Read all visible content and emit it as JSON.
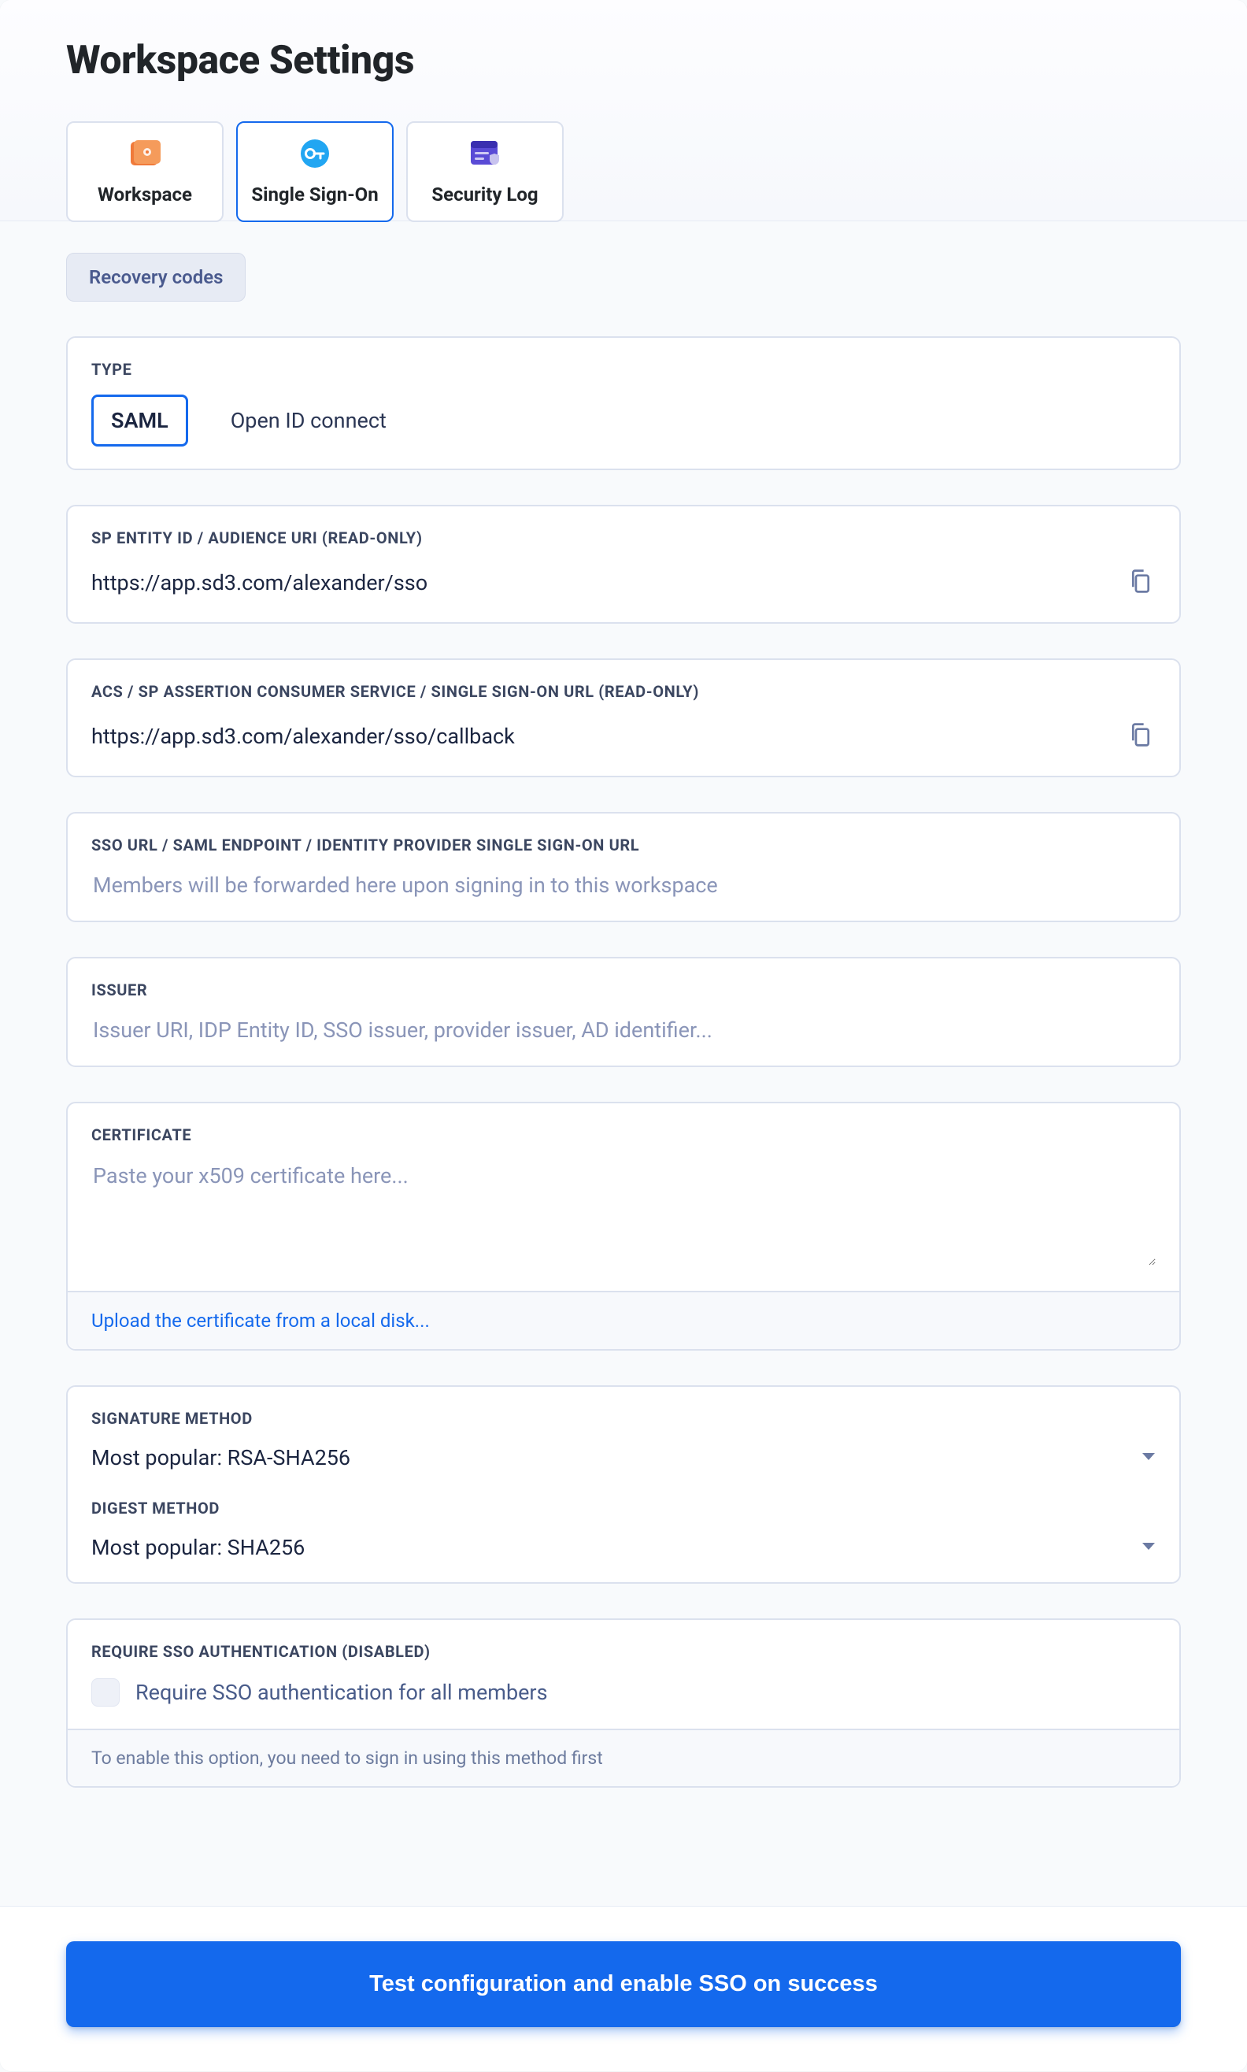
{
  "page_title": "Workspace Settings",
  "tabs": [
    {
      "label": "Workspace",
      "icon": "workspace-icon"
    },
    {
      "label": "Single Sign-On",
      "icon": "key-icon"
    },
    {
      "label": "Security Log",
      "icon": "security-log-icon"
    }
  ],
  "active_tab": "Single Sign-On",
  "recovery_codes_label": "Recovery codes",
  "type_section": {
    "label": "TYPE",
    "options": [
      "SAML",
      "Open ID connect"
    ],
    "selected": "SAML"
  },
  "sp_entity": {
    "label": "SP ENTITY ID / AUDIENCE URI (READ-ONLY)",
    "value": "https://app.sd3.com/alexander/sso"
  },
  "acs": {
    "label": "ACS / SP ASSERTION CONSUMER SERVICE / SINGLE SIGN-ON URL (READ-ONLY)",
    "value": "https://app.sd3.com/alexander/sso/callback"
  },
  "sso_url": {
    "label": "SSO URL / SAML ENDPOINT / IDENTITY PROVIDER SINGLE SIGN-ON URL",
    "placeholder": "Members will be forwarded here upon signing in to this workspace"
  },
  "issuer": {
    "label": "ISSUER",
    "placeholder": "Issuer URI, IDP Entity ID, SSO issuer, provider issuer, AD identifier..."
  },
  "certificate": {
    "label": "CERTIFICATE",
    "placeholder": "Paste your x509 certificate here...",
    "upload_link": "Upload the certificate from a local disk..."
  },
  "signature": {
    "label": "SIGNATURE METHOD",
    "value": "Most popular: RSA-SHA256"
  },
  "digest": {
    "label": "DIGEST METHOD",
    "value": "Most popular: SHA256"
  },
  "require_sso": {
    "label": "REQUIRE SSO AUTHENTICATION (DISABLED)",
    "checkbox_label": "Require SSO authentication for all members",
    "hint": "To enable this option, you need to sign in using this method first"
  },
  "primary_action": "Test configuration and enable SSO on success"
}
